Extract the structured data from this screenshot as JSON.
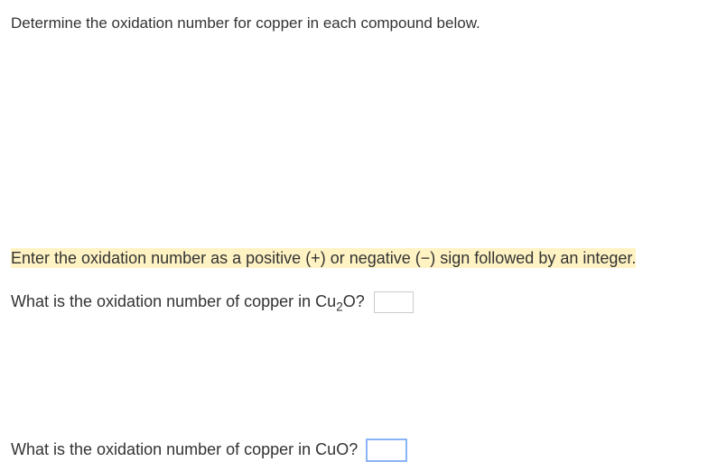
{
  "header": {
    "prompt": "Determine the oxidation number for copper in each compound below."
  },
  "instruction": {
    "text": "Enter the oxidation number as a positive (+) or negative (−) sign followed by an integer."
  },
  "questions": {
    "q1": {
      "prefix": "What is the oxidation number of copper in Cu",
      "subscript": "2",
      "suffix": "O?",
      "value": ""
    },
    "q2": {
      "prefix": "What is the oxidation number of copper in CuO?",
      "value": ""
    }
  }
}
